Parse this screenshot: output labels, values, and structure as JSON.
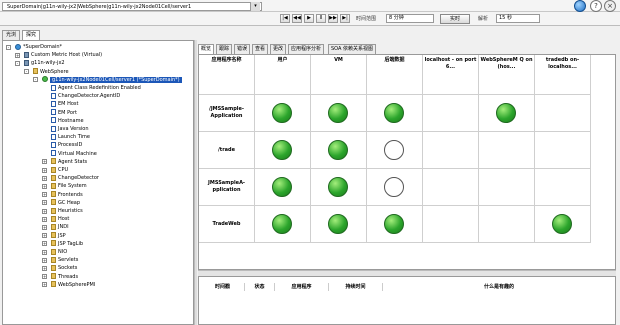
{
  "address_bar": "SuperDomain|g11n-wily-jx2|WebSphere|g11n-wily-jx2Node01Cell/server1",
  "time_controls": {
    "range_label": "时间范围",
    "range_value": "8 分钟",
    "live_button": "实时",
    "resolution_label": "解析",
    "resolution_value": "15 秒"
  },
  "left_tabs": [
    "光浏",
    "探究"
  ],
  "tree": [
    {
      "label": "*SuperDomain*",
      "level": 0,
      "icon": "globe",
      "expand": "-"
    },
    {
      "label": "Custom Metric Host (Virtual)",
      "level": 1,
      "icon": "db",
      "expand": "+"
    },
    {
      "label": "g11n-wily-jx2",
      "level": 1,
      "icon": "db",
      "expand": "-"
    },
    {
      "label": "WebSphere",
      "level": 2,
      "icon": "folder",
      "expand": "-"
    },
    {
      "label": "g11n-wily-jx2Node01Cell/server1 (*SuperDomain*)",
      "level": 3,
      "icon": "green",
      "expand": "-",
      "selected": true
    },
    {
      "label": "Agent Class Redefinition Enabled",
      "level": 4,
      "icon": "page"
    },
    {
      "label": "ChangeDetector.AgentID",
      "level": 4,
      "icon": "page"
    },
    {
      "label": "EM Host",
      "level": 4,
      "icon": "page"
    },
    {
      "label": "EM Port",
      "level": 4,
      "icon": "page"
    },
    {
      "label": "Hostname",
      "level": 4,
      "icon": "page"
    },
    {
      "label": "Java Version",
      "level": 4,
      "icon": "page"
    },
    {
      "label": "Launch Time",
      "level": 4,
      "icon": "page"
    },
    {
      "label": "ProcessID",
      "level": 4,
      "icon": "page"
    },
    {
      "label": "Virtual Machine",
      "level": 4,
      "icon": "page"
    },
    {
      "label": "Agent Stats",
      "level": 4,
      "icon": "folder",
      "expand": "+"
    },
    {
      "label": "CPU",
      "level": 4,
      "icon": "folder",
      "expand": "+"
    },
    {
      "label": "ChangeDetector",
      "level": 4,
      "icon": "folder",
      "expand": "+"
    },
    {
      "label": "File System",
      "level": 4,
      "icon": "folder",
      "expand": "+"
    },
    {
      "label": "Frontends",
      "level": 4,
      "icon": "folder",
      "expand": "+"
    },
    {
      "label": "GC Heap",
      "level": 4,
      "icon": "folder",
      "expand": "+"
    },
    {
      "label": "Heuristics",
      "level": 4,
      "icon": "folder",
      "expand": "+"
    },
    {
      "label": "Host",
      "level": 4,
      "icon": "folder",
      "expand": "+"
    },
    {
      "label": "JNDI",
      "level": 4,
      "icon": "folder",
      "expand": "+"
    },
    {
      "label": "JSP",
      "level": 4,
      "icon": "folder",
      "expand": "+"
    },
    {
      "label": "JSP TagLib",
      "level": 4,
      "icon": "folder",
      "expand": "+"
    },
    {
      "label": "NIO",
      "level": 4,
      "icon": "folder",
      "expand": "+"
    },
    {
      "label": "Servlets",
      "level": 4,
      "icon": "folder",
      "expand": "+"
    },
    {
      "label": "Sockets",
      "level": 4,
      "icon": "folder",
      "expand": "+"
    },
    {
      "label": "Threads",
      "level": 4,
      "icon": "folder",
      "expand": "+"
    },
    {
      "label": "WebSpherePMI",
      "level": 4,
      "icon": "folder",
      "expand": "+"
    }
  ],
  "right_tabs": [
    "概览",
    "跟踪",
    "错误",
    "查看",
    "更改",
    "应用程序分析",
    "SOA 依赖关系视图"
  ],
  "grid": {
    "corner": "应用程序名称",
    "columns": [
      "用户",
      "VM",
      "后端数据",
      "localhost - on port 6...",
      "WebSphereM Q on (hos...",
      "tradedb on-localhos..."
    ],
    "rows": [
      {
        "label": "/JMSSample-Application",
        "status": [
          "green",
          "green",
          "green",
          "",
          "green",
          ""
        ]
      },
      {
        "label": "/trade",
        "status": [
          "green",
          "green",
          "empty",
          "",
          "",
          ""
        ]
      },
      {
        "label": "JMSSampleA-pplication",
        "status": [
          "green",
          "green",
          "empty",
          "",
          "",
          ""
        ]
      },
      {
        "label": "TradeWeb",
        "status": [
          "green",
          "green",
          "green",
          "",
          "",
          "green"
        ]
      }
    ]
  },
  "events_headers": [
    "时间戳",
    "状态",
    "应用程序",
    "持续时间",
    "什么是有趣的"
  ]
}
